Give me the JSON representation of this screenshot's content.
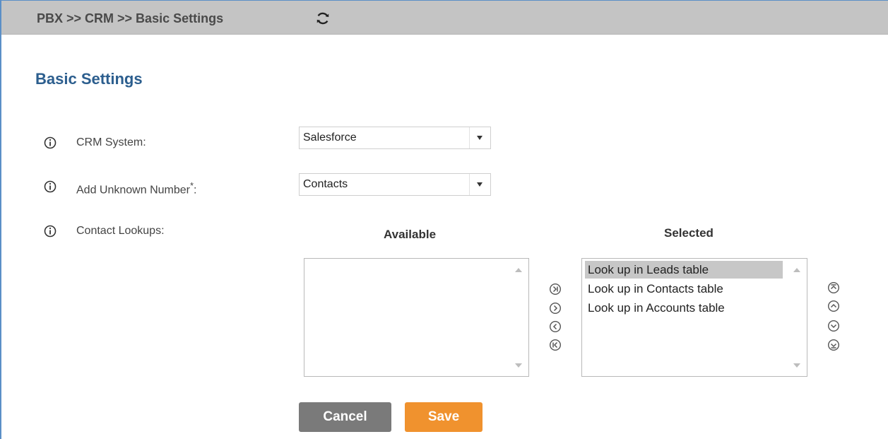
{
  "header": {
    "breadcrumb": "PBX >> CRM >> Basic Settings",
    "refresh_icon": "refresh-icon"
  },
  "page": {
    "title": "Basic Settings"
  },
  "fields": {
    "crm_system": {
      "label": "CRM System:",
      "value": "Salesforce"
    },
    "add_unknown_number": {
      "label": "Add Unknown Number",
      "required_mark": "*",
      "label_suffix": ":",
      "value": "Contacts"
    },
    "contact_lookups": {
      "label": "Contact Lookups:"
    }
  },
  "lookups": {
    "available_heading": "Available",
    "selected_heading": "Selected",
    "available_items": [],
    "selected_items": [
      "Look up in Leads table",
      "Look up in Contacts table",
      "Look up in Accounts table"
    ],
    "highlighted_index": 0
  },
  "buttons": {
    "cancel": "Cancel",
    "save": "Save"
  },
  "colors": {
    "title": "#2c5e8e",
    "save": "#f0922e",
    "cancel": "#7a7a7a",
    "topbar": "#c4c4c4"
  }
}
